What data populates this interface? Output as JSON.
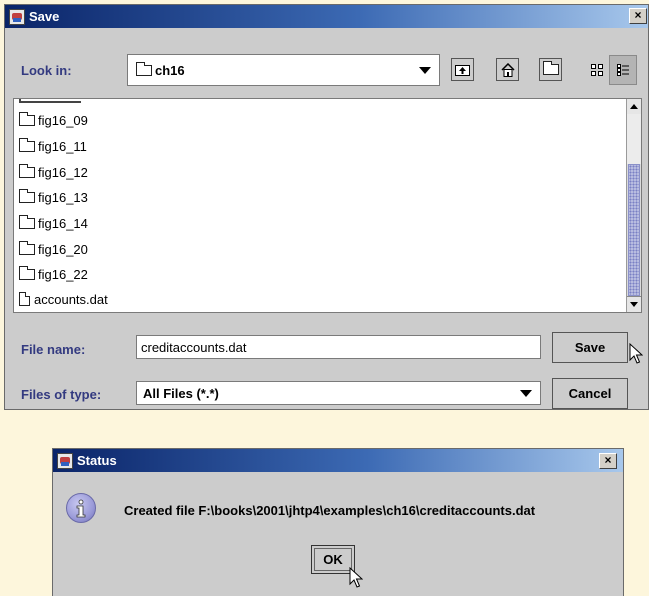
{
  "save_dialog": {
    "title": "Save",
    "close_glyph": "×",
    "look_in_label": "Look in:",
    "look_in_value": "ch16",
    "toolbar_icons": [
      "up-one-level-icon",
      "home-icon",
      "new-folder-icon",
      "list-view-icon",
      "details-view-icon"
    ],
    "files": [
      {
        "name": "fig16_09",
        "type": "folder"
      },
      {
        "name": "fig16_11",
        "type": "folder"
      },
      {
        "name": "fig16_12",
        "type": "folder"
      },
      {
        "name": "fig16_13",
        "type": "folder"
      },
      {
        "name": "fig16_14",
        "type": "folder"
      },
      {
        "name": "fig16_20",
        "type": "folder"
      },
      {
        "name": "fig16_22",
        "type": "folder"
      },
      {
        "name": "accounts.dat",
        "type": "file"
      }
    ],
    "file_name_label": "File name:",
    "file_name_value": "creditaccounts.dat",
    "files_of_type_label": "Files of type:",
    "files_of_type_value": "All Files (*.*)",
    "save_button": "Save",
    "cancel_button": "Cancel"
  },
  "status_dialog": {
    "title": "Status",
    "close_glyph": "×",
    "message": "Created file F:\\books\\2001\\jhtp4\\examples\\ch16\\creditaccounts.dat",
    "info_icon": "information-icon",
    "ok_button": "OK"
  },
  "colors": {
    "background": "#fdf6dc",
    "dialog_gray": "#cccccc",
    "label_blue": "#333a80",
    "titlebar_start": "#0a2468",
    "titlebar_end": "#a8c8ec"
  }
}
